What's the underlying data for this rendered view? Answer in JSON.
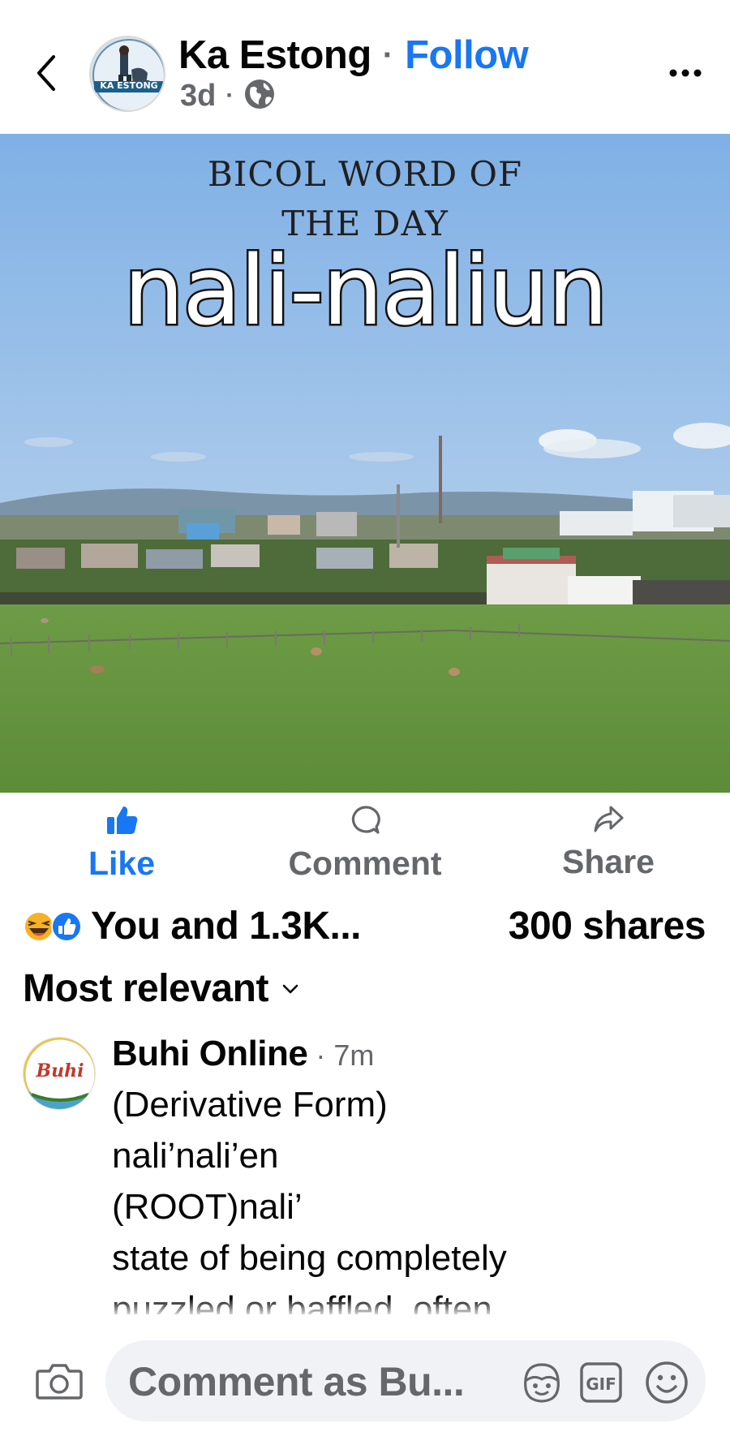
{
  "header": {
    "author_name": "Ka Estong",
    "separator": "·",
    "follow_label": "Follow",
    "time": "3d",
    "meta_separator": "·",
    "avatar_logo_text": "KA ESTONG",
    "audience_icon": "globe-icon"
  },
  "post_image": {
    "subtitle_line1": "BICOL WORD OF",
    "subtitle_line2": "THE DAY",
    "word": "nali-naliun"
  },
  "actions": {
    "like_label": "Like",
    "comment_label": "Comment",
    "share_label": "Share"
  },
  "reactions": {
    "summary": "You and 1.3K...",
    "shares": "300 shares",
    "icons": [
      "haha-reaction-icon",
      "like-reaction-icon"
    ]
  },
  "comments_sort": {
    "label": "Most relevant"
  },
  "comments": [
    {
      "author": "Buhi Online",
      "separator": "·",
      "time": "7m",
      "avatar_logo_text": "Buhi",
      "lines": [
        "(Derivative Form)",
        "nali’nali’en",
        "(ROOT)nali’",
        "state of being completely",
        "puzzled or baffled, often"
      ]
    }
  ],
  "composer": {
    "placeholder": "Comment as Bu..."
  },
  "colors": {
    "accent": "#1877f2",
    "secondary_text": "#65676b",
    "input_bg": "#f0f2f5"
  }
}
